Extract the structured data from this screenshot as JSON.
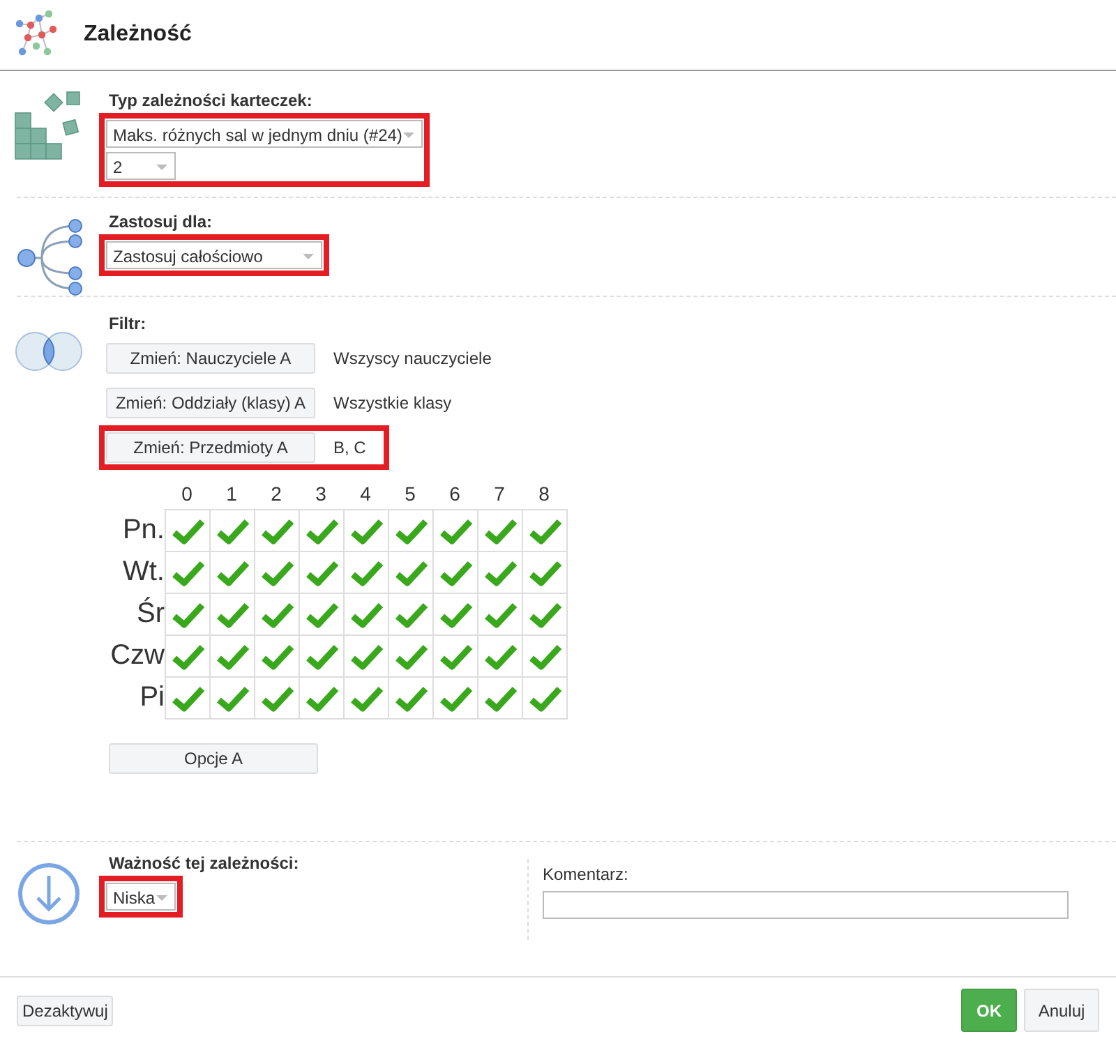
{
  "window": {
    "title": "Zależność"
  },
  "type_section": {
    "label": "Typ zależności karteczek:",
    "highlighted": true,
    "type_select": "Maks. różnych sal w jednym dniu (#24)",
    "count_select": "2"
  },
  "apply_section": {
    "label": "Zastosuj dla:",
    "highlighted": true,
    "select": "Zastosuj całościowo"
  },
  "filter": {
    "label": "Filtr:",
    "rows": [
      {
        "button": "Zmień: Nauczyciele A",
        "value": "Wszyscy nauczyciele",
        "highlighted": false
      },
      {
        "button": "Zmień: Oddziały (klasy) A",
        "value": "Wszystkie klasy",
        "highlighted": false
      },
      {
        "button": "Zmień: Przedmioty A",
        "value": "B, C",
        "highlighted": true
      }
    ],
    "periods": [
      "0",
      "1",
      "2",
      "3",
      "4",
      "5",
      "6",
      "7",
      "8"
    ],
    "days": [
      {
        "day": "Pn.",
        "cells": [
          {
            "checked": true
          },
          {
            "checked": true
          },
          {
            "checked": true
          },
          {
            "checked": true
          },
          {
            "checked": true
          },
          {
            "checked": true
          },
          {
            "checked": true
          },
          {
            "checked": true
          },
          {
            "checked": true
          }
        ]
      },
      {
        "day": "Wt.",
        "cells": [
          {
            "checked": true
          },
          {
            "checked": true
          },
          {
            "checked": true
          },
          {
            "checked": true
          },
          {
            "checked": true
          },
          {
            "checked": true
          },
          {
            "checked": true
          },
          {
            "checked": true
          },
          {
            "checked": true
          }
        ]
      },
      {
        "day": "Śr",
        "cells": [
          {
            "checked": true
          },
          {
            "checked": true
          },
          {
            "checked": true
          },
          {
            "checked": true
          },
          {
            "checked": true
          },
          {
            "checked": true
          },
          {
            "checked": true
          },
          {
            "checked": true
          },
          {
            "checked": true
          }
        ]
      },
      {
        "day": "Czw",
        "cells": [
          {
            "checked": true
          },
          {
            "checked": true
          },
          {
            "checked": true
          },
          {
            "checked": true
          },
          {
            "checked": true
          },
          {
            "checked": true
          },
          {
            "checked": true
          },
          {
            "checked": true
          },
          {
            "checked": true
          }
        ]
      },
      {
        "day": "Pi",
        "cells": [
          {
            "checked": true
          },
          {
            "checked": true
          },
          {
            "checked": true
          },
          {
            "checked": true
          },
          {
            "checked": true
          },
          {
            "checked": true
          },
          {
            "checked": true
          },
          {
            "checked": true
          },
          {
            "checked": true
          }
        ]
      }
    ],
    "options_button": "Opcje A"
  },
  "importance": {
    "label": "Ważność tej zależności:",
    "highlighted": true,
    "select": "Niska"
  },
  "comment": {
    "label": "Komentarz:"
  },
  "footer": {
    "deactivate": "Dezaktywuj",
    "ok": "OK",
    "cancel": "Anuluj"
  }
}
